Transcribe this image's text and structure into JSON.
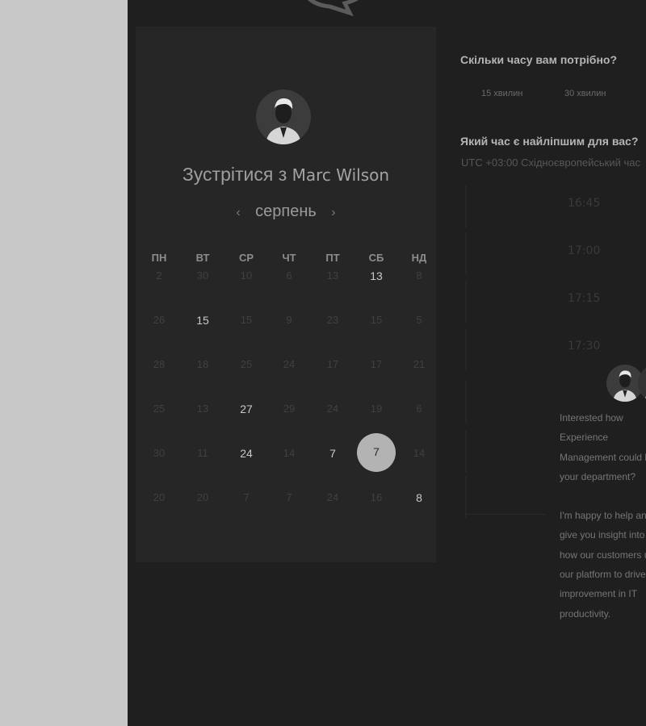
{
  "colors": {
    "panel_bg": "#1f1f1f",
    "card_bg": "#262626",
    "side_bg": "#c8c8c8",
    "selected_day_bg": "#b3b3b3"
  },
  "header": {
    "logo_icon": "chat-bubble-logo-icon"
  },
  "calendar": {
    "meet_prefix": "Зустрітися з",
    "host_name": "Marc Wilson",
    "month": "серпень",
    "prev_icon": "chevron-left-icon",
    "next_icon": "chevron-right-icon",
    "weekdays": [
      "ПН",
      "ВТ",
      "СР",
      "ЧТ",
      "ПТ",
      "СБ",
      "НД"
    ],
    "weeks": [
      [
        {
          "d": "2",
          "active": false
        },
        {
          "d": "30",
          "active": false
        },
        {
          "d": "10",
          "active": false
        },
        {
          "d": "6",
          "active": false
        },
        {
          "d": "13",
          "active": false
        },
        {
          "d": "13",
          "active": true
        },
        {
          "d": "8",
          "active": false
        }
      ],
      [
        {
          "d": "26",
          "active": false
        },
        {
          "d": "15",
          "active": true
        },
        {
          "d": "15",
          "active": false
        },
        {
          "d": "9",
          "active": false
        },
        {
          "d": "23",
          "active": false
        },
        {
          "d": "15",
          "active": false
        },
        {
          "d": "5",
          "active": false
        }
      ],
      [
        {
          "d": "28",
          "active": false
        },
        {
          "d": "18",
          "active": false
        },
        {
          "d": "25",
          "active": false
        },
        {
          "d": "24",
          "active": false
        },
        {
          "d": "17",
          "active": false
        },
        {
          "d": "17",
          "active": false
        },
        {
          "d": "21",
          "active": false
        }
      ],
      [
        {
          "d": "25",
          "active": false
        },
        {
          "d": "13",
          "active": false
        },
        {
          "d": "27",
          "active": true
        },
        {
          "d": "29",
          "active": false
        },
        {
          "d": "24",
          "active": false
        },
        {
          "d": "19",
          "active": false
        },
        {
          "d": "6",
          "active": false
        }
      ],
      [
        {
          "d": "30",
          "active": false
        },
        {
          "d": "11",
          "active": false
        },
        {
          "d": "24",
          "active": true
        },
        {
          "d": "14",
          "active": false
        },
        {
          "d": "7",
          "active": true
        },
        {
          "d": "7",
          "active": true,
          "selected": true
        },
        {
          "d": "14",
          "active": false
        }
      ],
      [
        {
          "d": "20",
          "active": false
        },
        {
          "d": "20",
          "active": false
        },
        {
          "d": "7",
          "active": false
        },
        {
          "d": "7",
          "active": false
        },
        {
          "d": "24",
          "active": false
        },
        {
          "d": "16",
          "active": false
        },
        {
          "d": "8",
          "active": true
        }
      ]
    ]
  },
  "duration": {
    "question": "Скільки часу вам потрібно?",
    "options": [
      "15 хвилин",
      "30 хвилин"
    ]
  },
  "time": {
    "question": "Який час є найліпшим для вас?",
    "timezone": "UTC +03:00 Східноєвропейський час",
    "slots": [
      "16:45",
      "17:00",
      "17:15",
      "17:30"
    ]
  },
  "note": {
    "paragraph1": "Interested how Experience Management could help your department?",
    "paragraph2": "I'm happy to help and give you insight into how our customers use our platform to drive improvement in IT productivity."
  }
}
